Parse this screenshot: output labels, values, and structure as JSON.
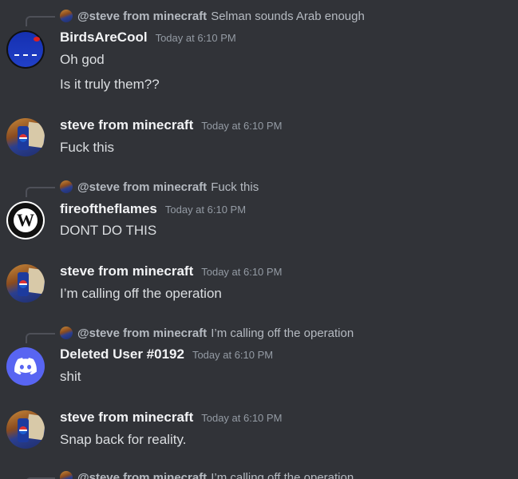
{
  "messages": [
    {
      "reply": {
        "mention": "@steve from minecraft",
        "text": "Selman sounds Arab enough"
      },
      "username": "BirdsAreCool",
      "timestamp": "Today at 6:10 PM",
      "avatar": "birds-avatar",
      "lines": [
        "Oh god",
        "Is it truly them??"
      ]
    },
    {
      "username": "steve from minecraft",
      "timestamp": "Today at 6:10 PM",
      "avatar": "steve-avatar",
      "lines": [
        "Fuck this"
      ]
    },
    {
      "reply": {
        "mention": "@steve from minecraft",
        "text": "Fuck this"
      },
      "username": "fireoftheflames",
      "timestamp": "Today at 6:10 PM",
      "avatar": "wildford-avatar",
      "lines": [
        "DONT DO THIS"
      ]
    },
    {
      "username": "steve from minecraft",
      "timestamp": "Today at 6:10 PM",
      "avatar": "steve-avatar",
      "lines": [
        "I’m calling off the operation"
      ]
    },
    {
      "reply": {
        "mention": "@steve from minecraft",
        "text": "I’m calling off the operation"
      },
      "username": "Deleted User #0192",
      "timestamp": "Today at 6:10 PM",
      "avatar": "discord-logo-avatar",
      "lines": [
        "shit"
      ]
    },
    {
      "username": "steve from minecraft",
      "timestamp": "Today at 6:10 PM",
      "avatar": "steve-avatar",
      "lines": [
        "Snap back for reality."
      ]
    },
    {
      "reply": {
        "mention": "@steve from minecraft",
        "text": "I’m calling off the operation"
      }
    }
  ],
  "colors": {
    "background": "#313338",
    "username": "#f2f3f5",
    "timestamp": "#949ba4",
    "message_text": "#dbdee1",
    "discord_blurple": "#5865f2"
  }
}
